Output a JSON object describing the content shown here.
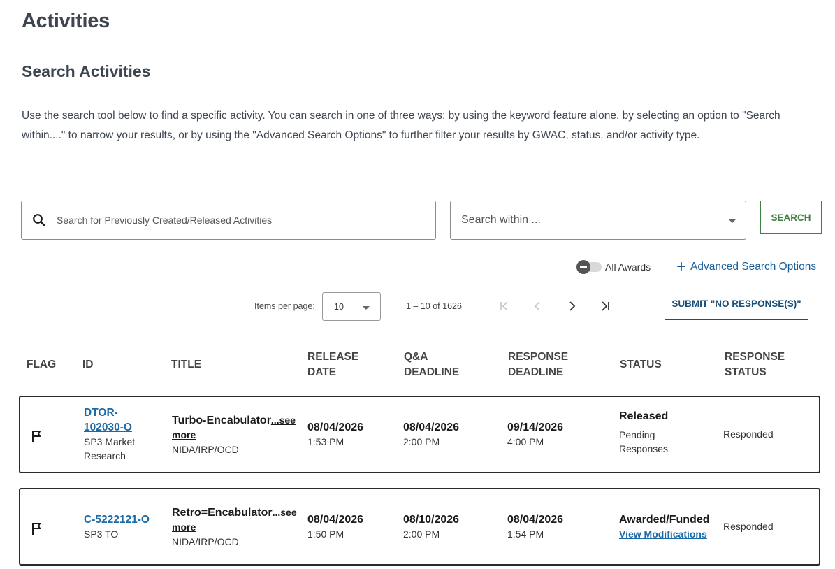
{
  "header": {
    "page_title": "Activities",
    "section_title": "Search Activities",
    "intro": "Use the search tool below to find a specific activity. You can search in one of three ways: by using the keyword feature alone, by selecting an option to \"Search within....\" to narrow your results, or by using the \"Advanced Search Options\" to further filter your results by GWAC, status, and/or activity type."
  },
  "search": {
    "placeholder": "Search for Previously Created/Released Activities",
    "value": "",
    "within_placeholder": "Search within ...",
    "button_label": "SEARCH"
  },
  "filters": {
    "toggle_label": "All Awards",
    "toggle_on": false,
    "advanced_label": "Advanced Search Options"
  },
  "pager": {
    "items_per_page_label": "Items per page:",
    "items_per_page_value": "10",
    "range": "1 – 10 of 1626"
  },
  "actions": {
    "submit_no_response": "SUBMIT \"NO RESPONSE(S)\""
  },
  "table": {
    "columns": [
      {
        "key": "flag",
        "line1": "FLAG",
        "line2": ""
      },
      {
        "key": "id",
        "line1": "ID",
        "line2": ""
      },
      {
        "key": "title",
        "line1": "TITLE",
        "line2": ""
      },
      {
        "key": "release",
        "line1": "RELEASE",
        "line2": "DATE"
      },
      {
        "key": "qa",
        "line1": "Q&A",
        "line2": "DEADLINE"
      },
      {
        "key": "response",
        "line1": "RESPONSE",
        "line2": "DEADLINE"
      },
      {
        "key": "status",
        "line1": "STATUS",
        "line2": ""
      },
      {
        "key": "response_status",
        "line1": "RESPONSE",
        "line2": "STATUS"
      }
    ],
    "rows": [
      {
        "id_line1": "DTOR-",
        "id_line2": "102030-O",
        "type_line1": "SP3 Market",
        "type_line2": "Research",
        "title": "Turbo-Encabulator",
        "see_more_1": "...see",
        "see_more_2": "more",
        "org": "NIDA/IRP/OCD",
        "release_date": "08/04/2026",
        "release_time": "1:53 PM",
        "qa_date": "08/04/2026",
        "qa_time": "2:00 PM",
        "response_date": "09/14/2026",
        "response_time": "4:00 PM",
        "status": "Released",
        "status_sub_1": "Pending",
        "status_sub_2": "Responses",
        "response_status": "Responded"
      },
      {
        "id_line1": "C-5222121-O",
        "type_line1": "SP3 TO",
        "title": "Retro=Encabulator",
        "see_more_1": "...see",
        "see_more_2": "more",
        "org": "NIDA/IRP/OCD",
        "release_date": "08/04/2026",
        "release_time": "1:50 PM",
        "qa_date": "08/10/2026",
        "qa_time": "2:00 PM",
        "response_date": "08/04/2026",
        "response_time": "1:54 PM",
        "status": "Awarded/Funded",
        "status_link": "View Modifications",
        "response_status": "Responded"
      }
    ]
  },
  "icons": {
    "search": "search-icon",
    "caret": "chevron-down-icon",
    "plus": "plus-icon",
    "first_page": "first-page-icon",
    "prev_page": "chevron-left-icon",
    "next_page": "chevron-right-icon",
    "last_page": "last-page-icon",
    "flag": "flag-icon"
  },
  "colors": {
    "heading": "#3d4551",
    "link": "#1a6aa8",
    "search_button": "#3f7f3f",
    "submit_button": "#1a4f7a",
    "row_border": "#2b2b2b"
  }
}
